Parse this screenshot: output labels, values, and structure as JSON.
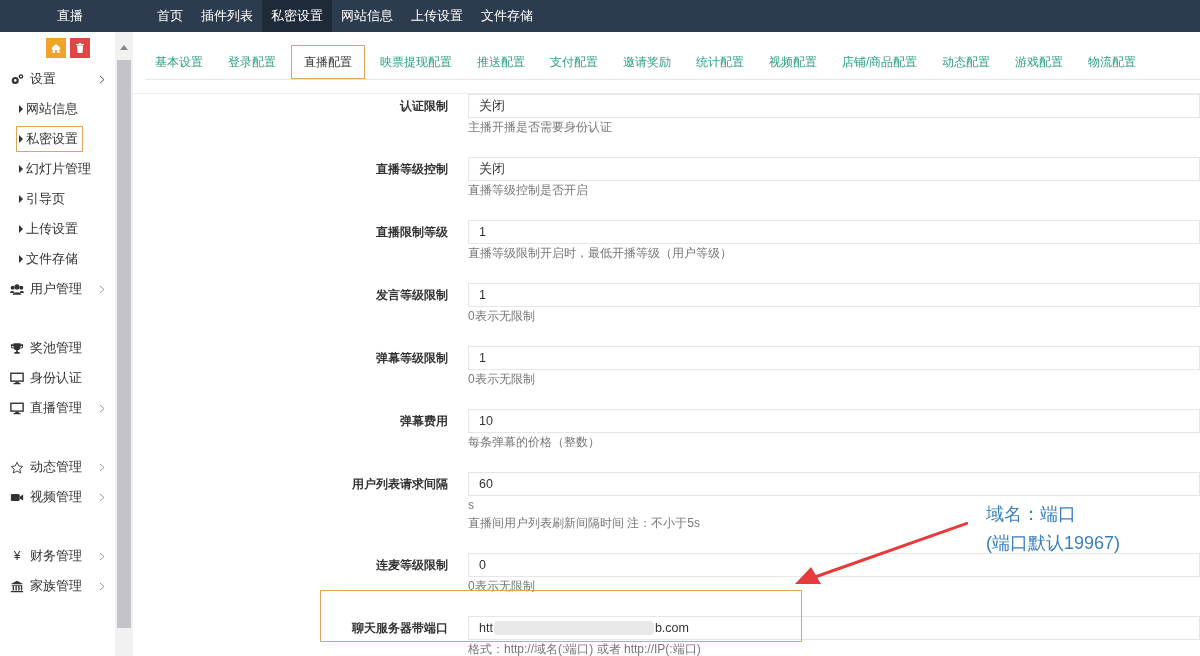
{
  "brand": "直播",
  "top_nav": [
    {
      "label": "首页",
      "selected": false
    },
    {
      "label": "插件列表",
      "selected": false
    },
    {
      "label": "私密设置",
      "selected": true
    },
    {
      "label": "网站信息",
      "selected": false
    },
    {
      "label": "上传设置",
      "selected": false
    },
    {
      "label": "文件存储",
      "selected": false
    }
  ],
  "sidebar": {
    "items": [
      {
        "label": "设置",
        "kind": "group",
        "expanded": true,
        "children": [
          {
            "label": "网站信息",
            "selected": false
          },
          {
            "label": "私密设置",
            "selected": true
          },
          {
            "label": "幻灯片管理",
            "selected": false
          },
          {
            "label": "引导页",
            "selected": false
          },
          {
            "label": "上传设置",
            "selected": false
          },
          {
            "label": "文件存储",
            "selected": false
          }
        ]
      },
      {
        "label": "用户管理",
        "kind": "group",
        "expanded": false
      },
      {
        "label": "奖池管理",
        "kind": "link"
      },
      {
        "label": "身份认证",
        "kind": "link"
      },
      {
        "label": "直播管理",
        "kind": "group",
        "expanded": false
      },
      {
        "label": "动态管理",
        "kind": "group",
        "expanded": false
      },
      {
        "label": "视频管理",
        "kind": "group",
        "expanded": false
      },
      {
        "label": "财务管理",
        "kind": "group",
        "expanded": false,
        "icon_char": "¥"
      },
      {
        "label": "家族管理",
        "kind": "group",
        "expanded": false
      }
    ]
  },
  "tabs": [
    {
      "label": "基本设置",
      "selected": false
    },
    {
      "label": "登录配置",
      "selected": false
    },
    {
      "label": "直播配置",
      "selected": true
    },
    {
      "label": "映票提现配置",
      "selected": false
    },
    {
      "label": "推送配置",
      "selected": false
    },
    {
      "label": "支付配置",
      "selected": false
    },
    {
      "label": "邀请奖励",
      "selected": false
    },
    {
      "label": "统计配置",
      "selected": false
    },
    {
      "label": "视频配置",
      "selected": false
    },
    {
      "label": "店铺/商品配置",
      "selected": false
    },
    {
      "label": "动态配置",
      "selected": false
    },
    {
      "label": "游戏配置",
      "selected": false
    },
    {
      "label": "物流配置",
      "selected": false
    }
  ],
  "form": [
    {
      "label": "认证限制",
      "value": "关闭",
      "help": "主播开播是否需要身份认证",
      "highlighted": false
    },
    {
      "label": "直播等级控制",
      "value": "关闭",
      "help": "直播等级控制是否开启",
      "highlighted": false
    },
    {
      "label": "直播限制等级",
      "value": "1",
      "help": "直播等级限制开启时，最低开播等级（用户等级）",
      "highlighted": false
    },
    {
      "label": "发言等级限制",
      "value": "1",
      "help": "0表示无限制",
      "highlighted": false
    },
    {
      "label": "弹幕等级限制",
      "value": "1",
      "help": "0表示无限制",
      "highlighted": false
    },
    {
      "label": "弹幕费用",
      "value": "10",
      "help": "每条弹幕的价格（整数）",
      "highlighted": false
    },
    {
      "label": "用户列表请求间隔",
      "value": "60",
      "unit": "s",
      "help": "直播间用户列表刷新间隔时间 注：不小于5s",
      "highlighted": false
    },
    {
      "label": "连麦等级限制",
      "value": "0",
      "help": "0表示无限制",
      "highlighted": false
    },
    {
      "label": "聊天服务器带端口",
      "value": "htt",
      "value_end": "b.com",
      "blurred": true,
      "help": "格式：http://域名(:端口) 或者 http://IP(:端口)",
      "highlighted": true
    }
  ],
  "annotation": {
    "lines": [
      "域名：端口",
      "(端口默认19967)"
    ]
  }
}
